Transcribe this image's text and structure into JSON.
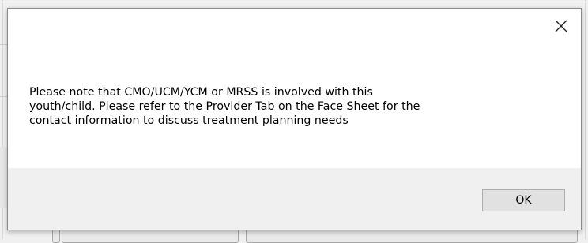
{
  "dialog": {
    "message_lines": [
      "Please note that CMO/UCM/YCM or MRSS is involved with this",
      "youth/child. Please refer to the Provider Tab on the Face Sheet for the",
      "contact information to discuss treatment planning needs"
    ],
    "ok_label": "OK",
    "close_icon": "close-icon"
  },
  "colors": {
    "dialog_background": "#ffffff",
    "footer_background": "#f0f0f0",
    "button_background": "#e1e1e1",
    "button_border": "#adadad"
  }
}
